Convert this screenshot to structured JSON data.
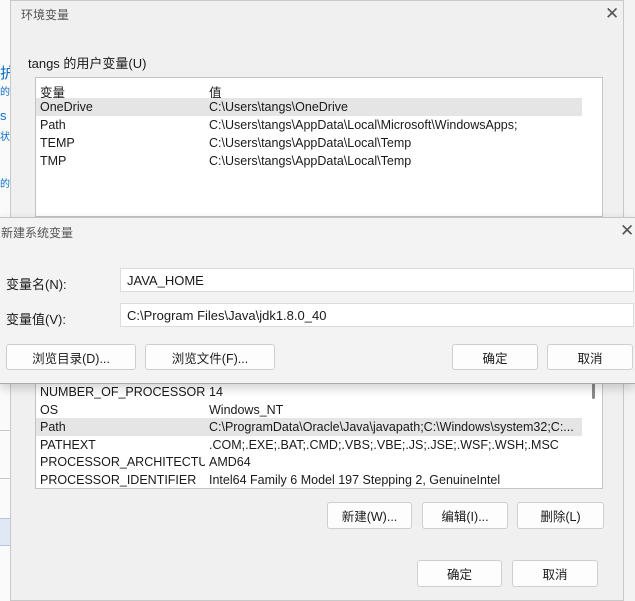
{
  "background": {
    "fragments": [
      "护",
      "的",
      "s",
      "状",
      "的"
    ]
  },
  "env_dialog": {
    "title": "环境变量",
    "user_group_label": "tangs 的用户变量(U)",
    "headers": {
      "name": "变量",
      "value": "值"
    },
    "user_vars": [
      {
        "name": "OneDrive",
        "value": "C:\\Users\\tangs\\OneDrive",
        "selected": true
      },
      {
        "name": "Path",
        "value": "C:\\Users\\tangs\\AppData\\Local\\Microsoft\\WindowsApps;"
      },
      {
        "name": "TEMP",
        "value": "C:\\Users\\tangs\\AppData\\Local\\Temp"
      },
      {
        "name": "TMP",
        "value": "C:\\Users\\tangs\\AppData\\Local\\Temp"
      }
    ],
    "system_vars": [
      {
        "name": "NUMBER_OF_PROCESSORS",
        "value": "14"
      },
      {
        "name": "OS",
        "value": "Windows_NT"
      },
      {
        "name": "Path",
        "value": "C:\\ProgramData\\Oracle\\Java\\javapath;C:\\Windows\\system32;C:...",
        "selected": true
      },
      {
        "name": "PATHEXT",
        "value": ".COM;.EXE;.BAT;.CMD;.VBS;.VBE;.JS;.JSE;.WSF;.WSH;.MSC"
      },
      {
        "name": "PROCESSOR_ARCHITECTU...",
        "value": "AMD64"
      },
      {
        "name": "PROCESSOR_IDENTIFIER",
        "value": "Intel64 Family 6 Model 197 Stepping 2, GenuineIntel"
      }
    ],
    "buttons": {
      "new": "新建(W)...",
      "edit": "编辑(I)...",
      "delete": "删除(L)",
      "ok": "确定",
      "cancel": "取消"
    }
  },
  "new_var_dialog": {
    "title": "新建系统变量",
    "name_label": "变量名(N):",
    "name_value": "JAVA_HOME",
    "value_label": "变量值(V):",
    "value_value": "C:\\Program Files\\Java\\jdk1.8.0_40",
    "buttons": {
      "browse_dir": "浏览目录(D)...",
      "browse_file": "浏览文件(F)...",
      "ok": "确定",
      "cancel": "取消"
    }
  }
}
